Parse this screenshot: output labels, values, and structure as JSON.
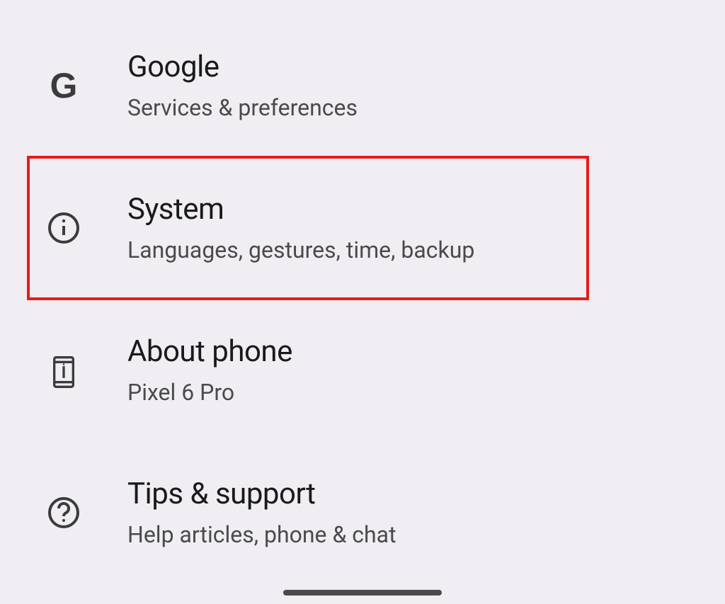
{
  "settings": [
    {
      "id": "google",
      "title": "Google",
      "subtitle": "Services & preferences",
      "icon": "google-g-icon"
    },
    {
      "id": "system",
      "title": "System",
      "subtitle": "Languages, gestures, time, backup",
      "icon": "info-circle-icon",
      "highlighted": true
    },
    {
      "id": "about-phone",
      "title": "About phone",
      "subtitle": "Pixel 6 Pro",
      "icon": "phone-icon"
    },
    {
      "id": "tips-support",
      "title": "Tips & support",
      "subtitle": "Help articles, phone & chat",
      "icon": "help-circle-icon"
    }
  ]
}
